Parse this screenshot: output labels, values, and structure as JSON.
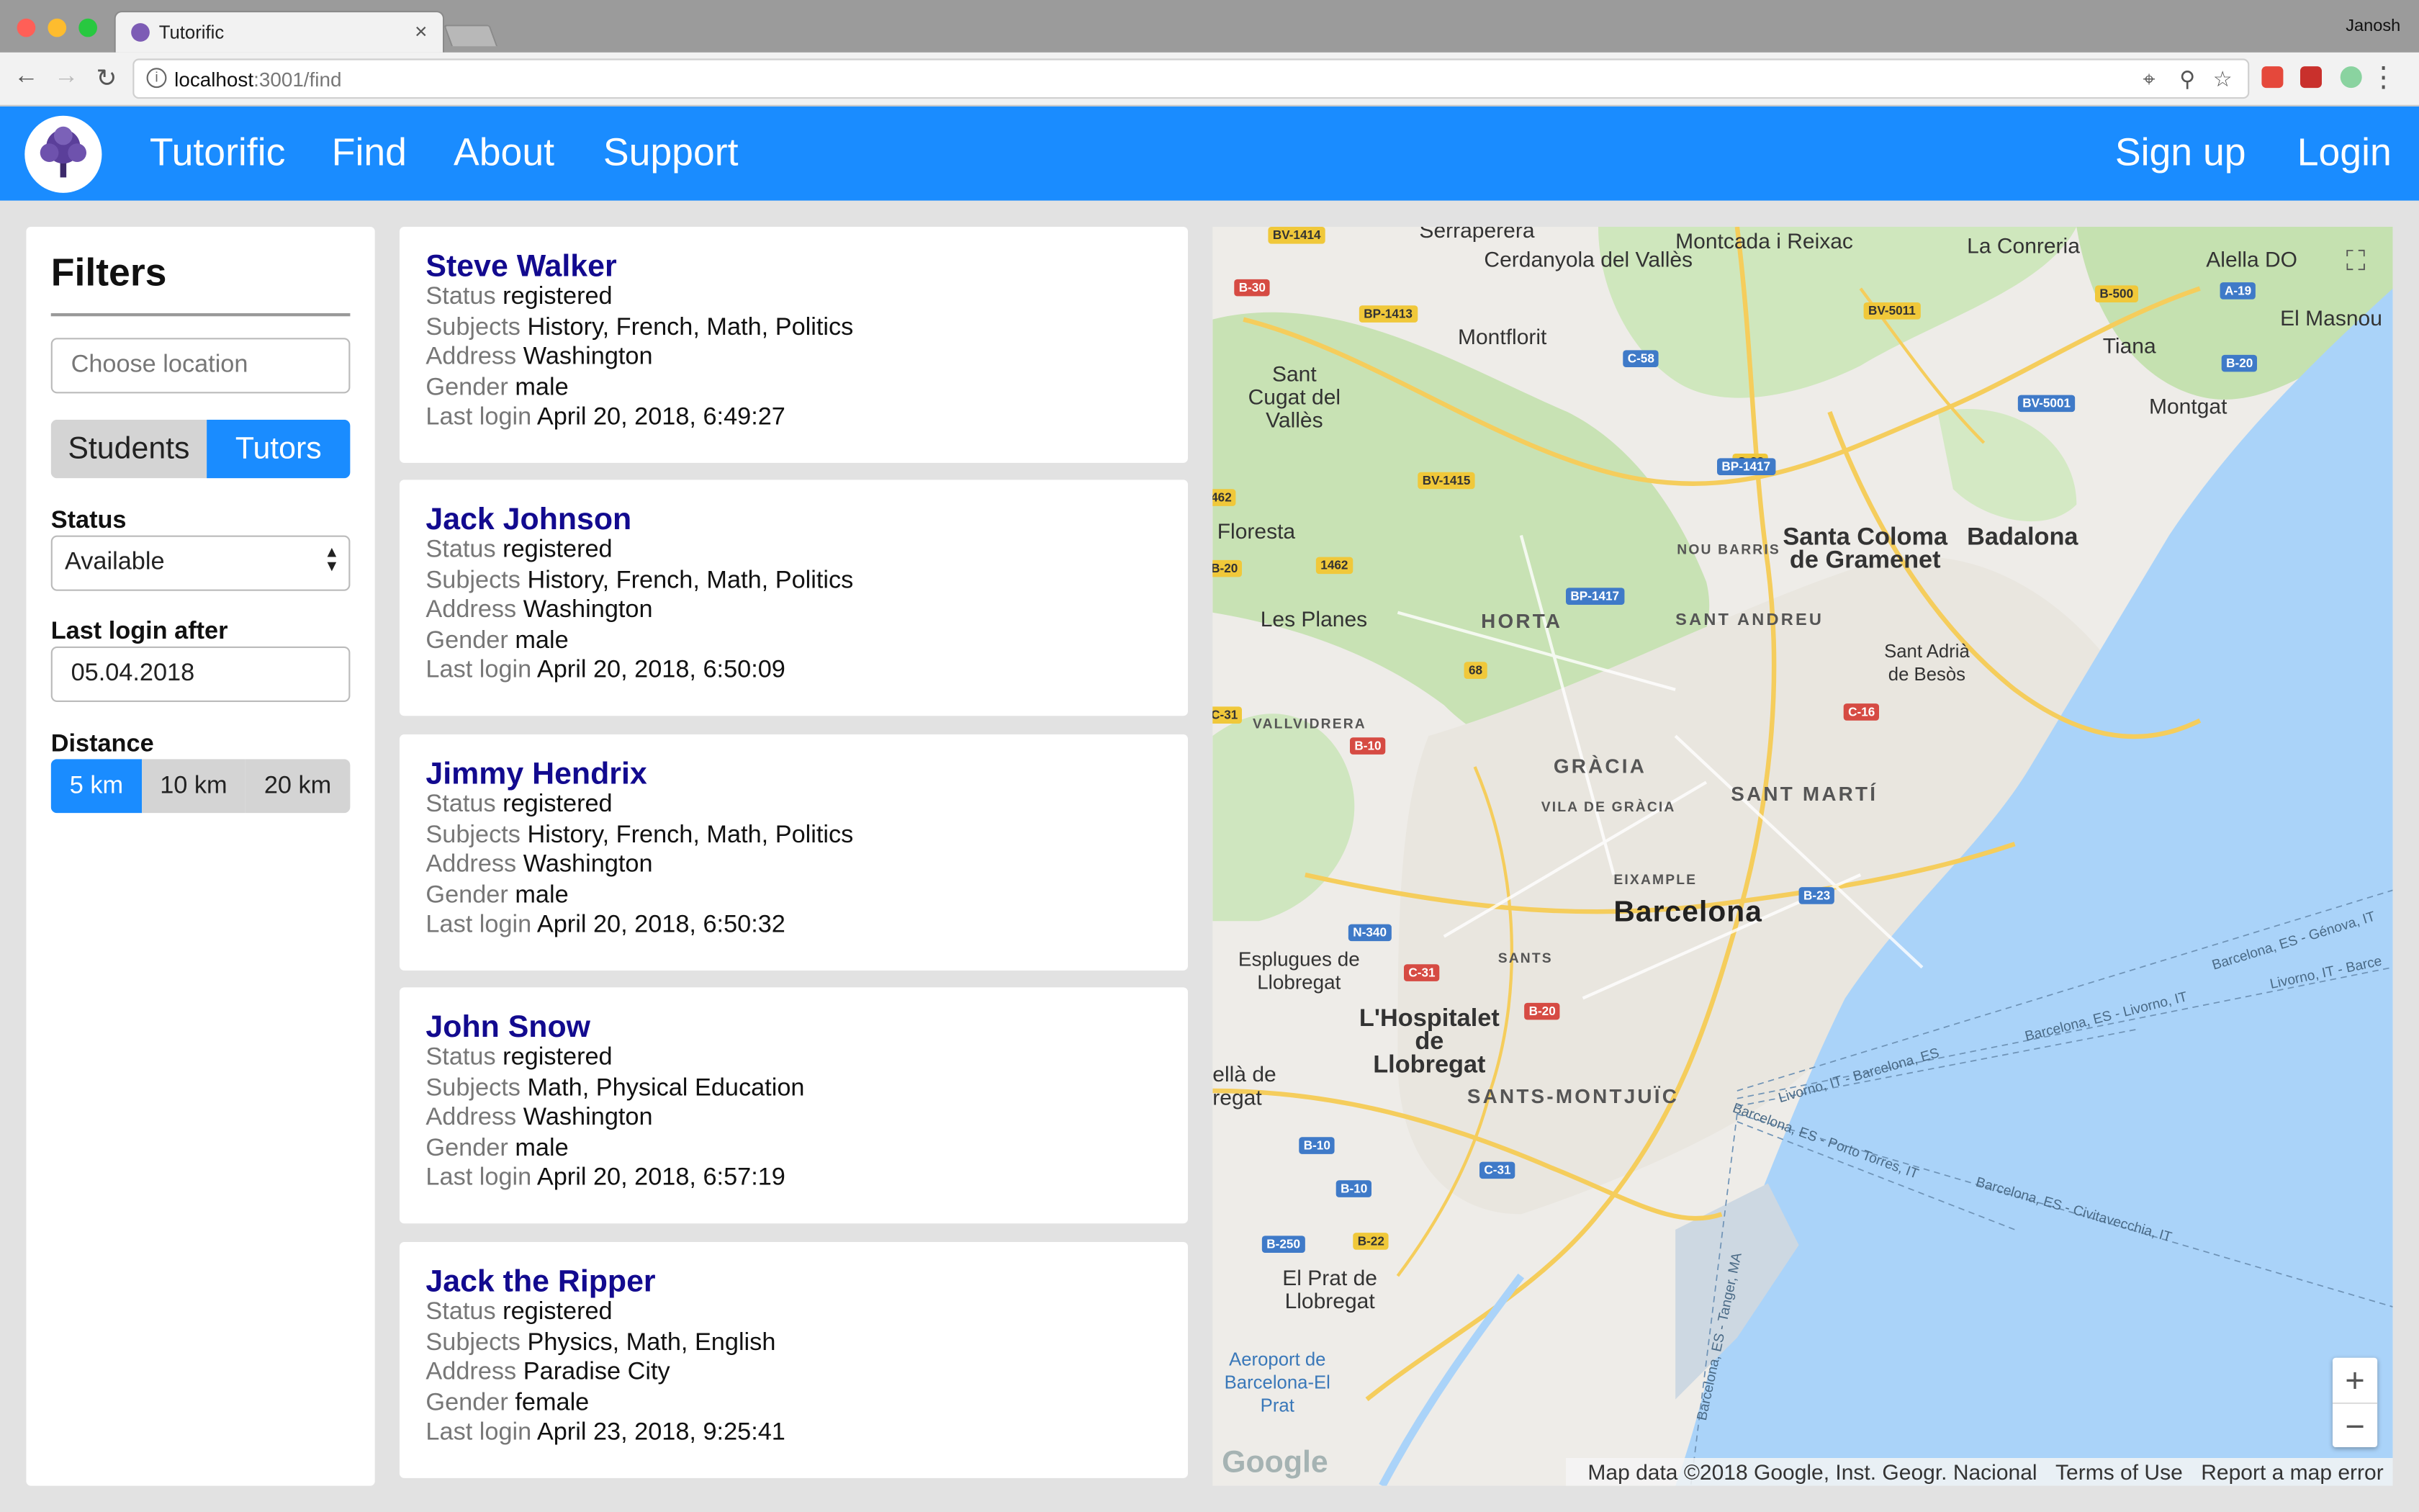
{
  "browser": {
    "tab_title": "Tutorific",
    "tab_close": "×",
    "profile": "Janosh",
    "url_host": "localhost",
    "url_rest": ":3001/find",
    "colors": {
      "close": "#ff5f57",
      "minimize": "#febc2e",
      "maximize": "#28c840"
    }
  },
  "navbar": {
    "brand": "Tutorific",
    "links": [
      "Find",
      "About",
      "Support"
    ],
    "signup": "Sign up",
    "login": "Login",
    "color": "#1a8cff"
  },
  "filters": {
    "title": "Filters",
    "location_placeholder": "Choose location",
    "role_toggle": [
      {
        "label": "Students",
        "active": false
      },
      {
        "label": "Tutors",
        "active": true
      }
    ],
    "status_label": "Status",
    "status_value": "Available",
    "login_label": "Last login after",
    "login_value": "05.04.2018",
    "distance_label": "Distance",
    "distance_options": [
      {
        "label": "5 km",
        "active": true
      },
      {
        "label": "10 km",
        "active": false
      },
      {
        "label": "20 km",
        "active": false
      }
    ]
  },
  "field_labels": {
    "status": "Status",
    "subjects": "Subjects",
    "address": "Address",
    "gender": "Gender",
    "last_login": "Last login"
  },
  "users": [
    {
      "name": "Steve Walker",
      "status": "registered",
      "subjects": "History, French, Math, Politics",
      "address": "Washington",
      "gender": "male",
      "last_login": "April 20, 2018, 6:49:27"
    },
    {
      "name": "Jack Johnson",
      "status": "registered",
      "subjects": "History, French, Math, Politics",
      "address": "Washington",
      "gender": "male",
      "last_login": "April 20, 2018, 6:50:09"
    },
    {
      "name": "Jimmy Hendrix",
      "status": "registered",
      "subjects": "History, French, Math, Politics",
      "address": "Washington",
      "gender": "male",
      "last_login": "April 20, 2018, 6:50:32"
    },
    {
      "name": "John Snow",
      "status": "registered",
      "subjects": "Math, Physical Education",
      "address": "Washington",
      "gender": "male",
      "last_login": "April 20, 2018, 6:57:19"
    },
    {
      "name": "Jack the Ripper",
      "status": "registered",
      "subjects": "Physics, Math, English",
      "address": "Paradise City",
      "gender": "female",
      "last_login": "April 23, 2018, 9:25:41"
    }
  ],
  "map": {
    "labels": {
      "cerdanyola": "Cerdanyola del Vallès",
      "montcada": "Montcada i Reixac",
      "serraperera": "Serraperera",
      "la_conreria": "La Conreria",
      "alella": "Alella DO",
      "el_masnou": "El Masnou",
      "tiana": "Tiana",
      "montgat": "Montgat",
      "montflorit": "Montflorit",
      "sant_cugat": "Sant Cugat del Vallès",
      "floresta": "Floresta",
      "les_planes": "Les Planes",
      "horta": "HORTA",
      "nou_barris": "NOU BARRIS",
      "santa_coloma": "Santa Coloma de Gramenet",
      "badalona": "Badalona",
      "sant_andreu": "SANT ANDREU",
      "sant_adria": "Sant Adrià de Besòs",
      "vallvidrera": "VALLVIDRERA",
      "gracia": "GRÀCIA",
      "vila_gracia": "VILA DE GRÀCIA",
      "sant_marti": "SANT MARTÍ",
      "eixample": "EIXAMPLE",
      "barcelona": "Barcelona",
      "esplugues": "Esplugues de Llobregat",
      "sants": "SANTS",
      "hospitalet": "L'Hospitalet de Llobregat",
      "santa_montjuic": "SANTS-MONTJUÏC",
      "ella_de_regat": "ellà de regat",
      "el_prat": "El Prat de Llobregat",
      "aeroport": "Aeroport de Barcelona-El Prat"
    },
    "routes": [
      "Barcelona, ES - Génova, IT",
      "Livorno, IT - Barce",
      "Barcelona, ES - Livorno, IT",
      "Livorno, IT - Barcelona, ES",
      "Barcelona, ES - Porto Torres, IT",
      "Barcelona, ES - Civitavecchia, IT",
      "Barcelona, ES - Tanger, MA"
    ],
    "road_badges": [
      "BV-1414",
      "B-30",
      "BP-1413",
      "C-58",
      "BV-5011",
      "B-500",
      "A-19",
      "B-20",
      "BV-5001",
      "C-33",
      "BV-1415",
      "462",
      "BP-1417",
      "1462",
      "B-20",
      "BP-1417",
      "68",
      "C-31",
      "C-16",
      "B-10",
      "B-23",
      "N-340",
      "C-31",
      "B-20",
      "B-10",
      "B-10",
      "C-31",
      "B-250",
      "B-22"
    ],
    "zoom_in": "+",
    "zoom_out": "−",
    "google": "Google",
    "attribution": "Map data ©2018 Google, Inst. Geogr. Nacional",
    "terms": "Terms of Use",
    "report": "Report a map error",
    "colors": {
      "water": "#aad3f9",
      "land": "#eeece8",
      "park": "#c8e2b4",
      "highway": "#f5cd5c"
    }
  }
}
